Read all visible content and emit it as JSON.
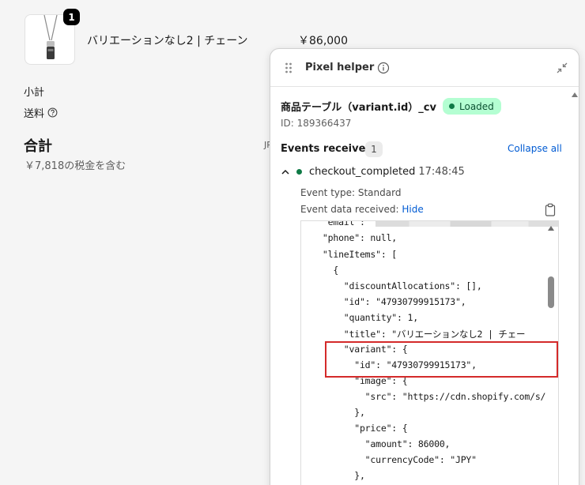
{
  "product": {
    "quantity": "1",
    "title": "バリエーションなし2 | チェーン",
    "price": "￥86,000"
  },
  "summary": {
    "subtotal_label": "小計",
    "shipping_label": "送料",
    "total_label": "合計",
    "tax_note": "￥7,818の税金を含む",
    "currency_peek": "JP"
  },
  "panel": {
    "title": "Pixel helper",
    "pixel_name": "商品テーブル（variant.id）_cv",
    "status": "Loaded",
    "pixel_id": "ID: 189366437",
    "events_label": "Events received",
    "events_count": "1",
    "collapse_all": "Collapse all",
    "event": {
      "name": "checkout_completed",
      "time": "17:48:45",
      "type_line": "Event type: Standard",
      "data_label": "Event data received: ",
      "hide_link": "Hide"
    }
  },
  "json_lines": {
    "l0_pre": "    \"email\": \"",
    "l0_post": "\",",
    "l1": "    \"phone\": null,",
    "l2": "    \"lineItems\": [",
    "l3": "      {",
    "l4": "        \"discountAllocations\": [],",
    "l5": "        \"id\": \"47930799915173\",",
    "l6": "        \"quantity\": 1,",
    "l7": "        \"title\": \"バリエーションなし2 | チェー",
    "l8": "        \"variant\": {",
    "l9": "          \"id\": \"47930799915173\",",
    "l10": "          \"image\": {",
    "l11": "            \"src\": \"https://cdn.shopify.com/s/",
    "l12": "          },",
    "l13": "          \"price\": {",
    "l14": "            \"amount\": 86000,",
    "l15": "            \"currencyCode\": \"JPY\"",
    "l16": "          },"
  },
  "colors": {
    "accent_link": "#005bd3",
    "status_bg": "#b4fed2",
    "status_dot": "#0f7a46",
    "highlight": "#d42a2a"
  },
  "icons": [
    "drag-handle-icon",
    "info-icon",
    "collapse-icon",
    "help-icon",
    "chevron-up-icon",
    "clipboard-icon",
    "scroll-up-arrow-icon",
    "product-necklace-image"
  ]
}
